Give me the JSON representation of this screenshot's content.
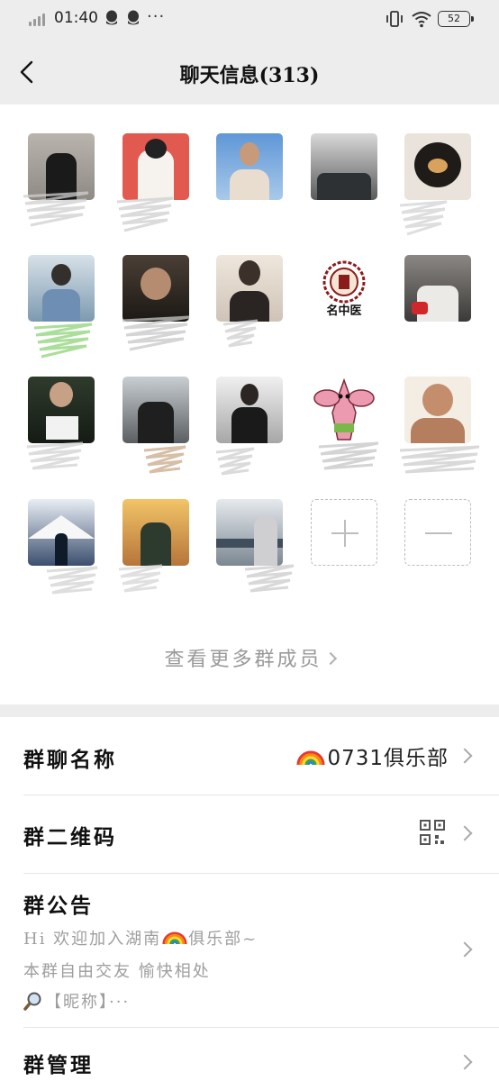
{
  "status": {
    "time": "01:40",
    "dots": "···",
    "battery": "52"
  },
  "nav": {
    "title": "聊天信息(313)"
  },
  "members": {
    "more_label": "查看更多群成员"
  },
  "settings": {
    "group_name_label": "群聊名称",
    "group_name_value": "0731俱乐部",
    "qr_label": "群二维码",
    "notice_label": "群公告",
    "notice_line1_a": "Hi 欢迎加入湖南",
    "notice_line1_b": "俱乐部~",
    "notice_line2": "本群自由交友 愉快相处",
    "notice_line3": "【昵称】···",
    "manage_label": "群管理"
  },
  "icons": [
    "back-icon",
    "qq-icon",
    "vibrate-icon",
    "wifi-icon",
    "battery-icon",
    "plus-icon",
    "minus-icon",
    "qr-code-icon",
    "rainbow-icon",
    "magnifier-icon",
    "chevron-right-icon"
  ],
  "colors": {
    "background": "#ededed",
    "panel": "#ffffff",
    "muted_text": "#9e9e9e"
  }
}
